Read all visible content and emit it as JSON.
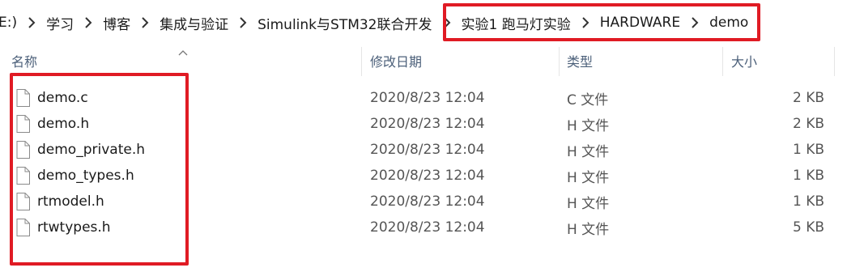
{
  "breadcrumb": {
    "segments": [
      "E:)",
      "学习",
      "博客",
      "集成与验证",
      "Simulink与STM32联合开发",
      "实验1 跑马灯实验",
      "HARDWARE",
      "demo"
    ]
  },
  "columns": {
    "name": "名称",
    "date": "修改日期",
    "type": "类型",
    "size": "大小"
  },
  "files": [
    {
      "name": "demo.c",
      "date": "2020/8/23 12:04",
      "type": "C 文件",
      "size": "2 KB"
    },
    {
      "name": "demo.h",
      "date": "2020/8/23 12:04",
      "type": "H 文件",
      "size": "2 KB"
    },
    {
      "name": "demo_private.h",
      "date": "2020/8/23 12:04",
      "type": "H 文件",
      "size": "1 KB"
    },
    {
      "name": "demo_types.h",
      "date": "2020/8/23 12:04",
      "type": "H 文件",
      "size": "1 KB"
    },
    {
      "name": "rtmodel.h",
      "date": "2020/8/23 12:04",
      "type": "H 文件",
      "size": "1 KB"
    },
    {
      "name": "rtwtypes.h",
      "date": "2020/8/23 12:04",
      "type": "H 文件",
      "size": "5 KB"
    }
  ],
  "colors": {
    "highlight": "#e01b24",
    "header_text": "#4c607a"
  },
  "icons": {
    "separator": "chevron-right-icon",
    "file": "file-icon",
    "sort": "sort-up-icon"
  }
}
